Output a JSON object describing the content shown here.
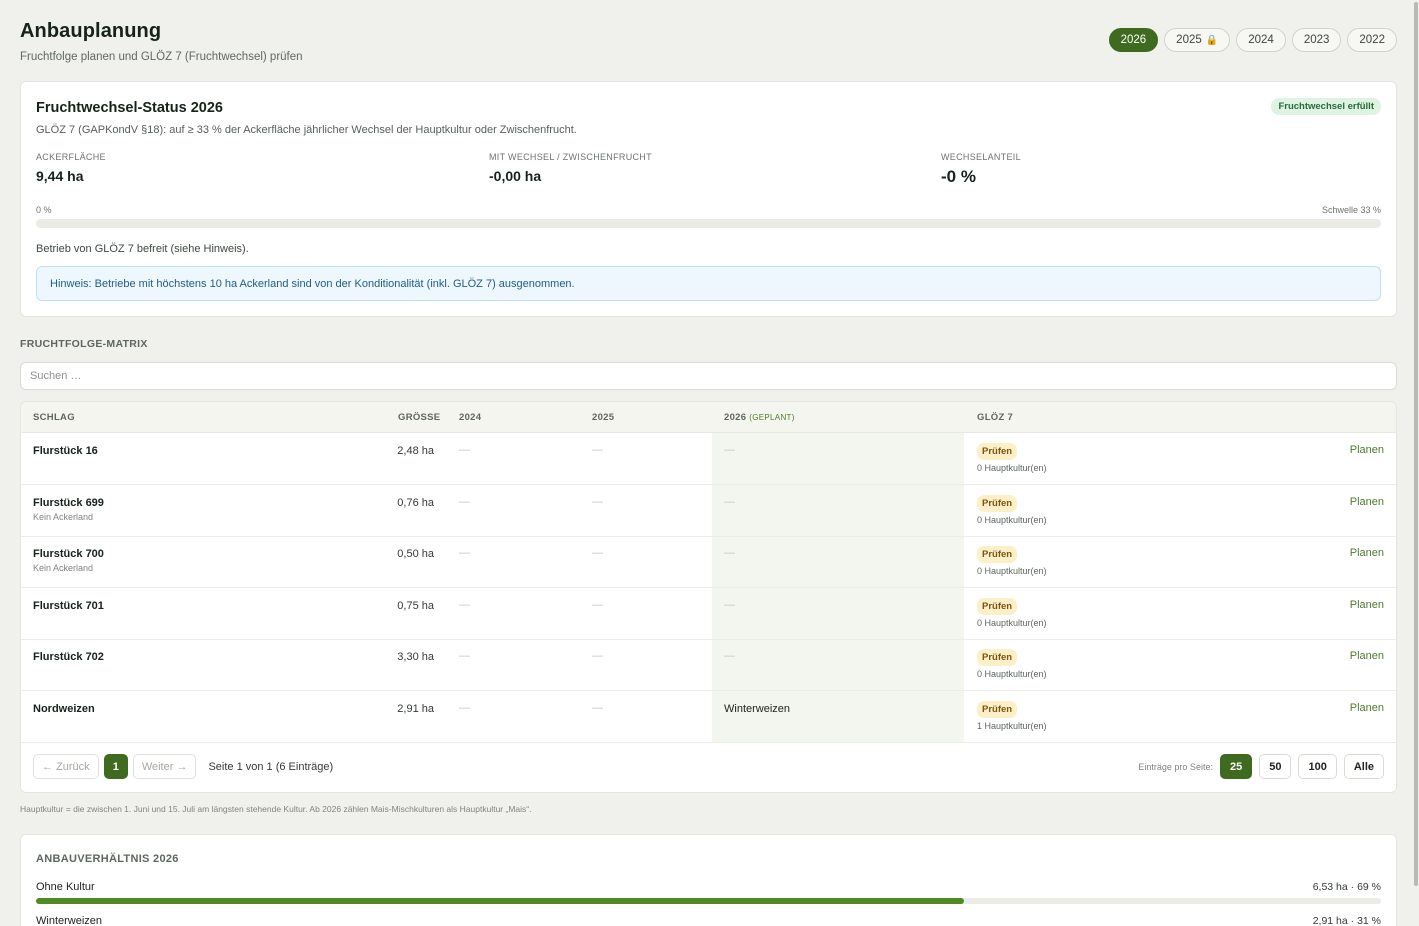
{
  "header": {
    "title": "Anbauplanung",
    "subtitle": "Fruchtfolge planen und GLÖZ 7 (Fruchtwechsel) prüfen"
  },
  "years": [
    {
      "label": "2026",
      "active": true,
      "locked": false
    },
    {
      "label": "2025",
      "active": false,
      "locked": true
    },
    {
      "label": "2024",
      "active": false,
      "locked": false
    },
    {
      "label": "2023",
      "active": false,
      "locked": false
    },
    {
      "label": "2022",
      "active": false,
      "locked": false
    }
  ],
  "status": {
    "title": "Fruchtwechsel-Status 2026",
    "description": "GLÖZ 7 (GAPKondV §18): auf ≥ 33 % der Ackerfläche jährlicher Wechsel der Hauptkultur oder Zwischenfrucht.",
    "badge": "Fruchtwechsel erfüllt",
    "stats": [
      {
        "label": "Ackerfläche",
        "value": "9,44 ha"
      },
      {
        "label": "Mit Wechsel / Zwischenfrucht",
        "value": "-0,00 ha"
      },
      {
        "label": "Wechselanteil",
        "value": "-0 %"
      }
    ],
    "progress_left": "0 %",
    "progress_right": "Schwelle 33 %",
    "progress_fraction": 0,
    "exempt_text": "Betrieb von GLÖZ 7 befreit (siehe Hinweis).",
    "hint": "Hinweis: Betriebe mit höchstens 10 ha Ackerland sind von der Konditionalität (inkl. GLÖZ 7) ausgenommen."
  },
  "matrix": {
    "section_title": "Fruchtfolge-Matrix",
    "search_placeholder": "Suchen …",
    "columns": {
      "schlag": "Schlag",
      "groesse": "Größe",
      "y2024": "2024",
      "y2025": "2025",
      "y2026": "2026",
      "y2026_note": "(geplant)",
      "gloez": "GLÖZ 7"
    },
    "rows": [
      {
        "name": "Flurstück 16",
        "note": "",
        "size": "2,48 ha",
        "c2024": "—",
        "c2025": "—",
        "c2026": "—",
        "check": "Prüfen",
        "hk": "0 Hauptkultur(en)",
        "action": "Planen"
      },
      {
        "name": "Flurstück 699",
        "note": "Kein Ackerland",
        "size": "0,76 ha",
        "c2024": "—",
        "c2025": "—",
        "c2026": "—",
        "check": "Prüfen",
        "hk": "0 Hauptkultur(en)",
        "action": "Planen"
      },
      {
        "name": "Flurstück 700",
        "note": "Kein Ackerland",
        "size": "0,50 ha",
        "c2024": "—",
        "c2025": "—",
        "c2026": "—",
        "check": "Prüfen",
        "hk": "0 Hauptkultur(en)",
        "action": "Planen"
      },
      {
        "name": "Flurstück 701",
        "note": "",
        "size": "0,75 ha",
        "c2024": "—",
        "c2025": "—",
        "c2026": "—",
        "check": "Prüfen",
        "hk": "0 Hauptkultur(en)",
        "action": "Planen"
      },
      {
        "name": "Flurstück 702",
        "note": "",
        "size": "3,30 ha",
        "c2024": "—",
        "c2025": "—",
        "c2026": "—",
        "check": "Prüfen",
        "hk": "0 Hauptkultur(en)",
        "action": "Planen"
      },
      {
        "name": "Nordweizen",
        "note": "",
        "size": "2,91 ha",
        "c2024": "—",
        "c2025": "—",
        "c2026": "Winterweizen",
        "check": "Prüfen",
        "hk": "1 Hauptkultur(en)",
        "action": "Planen"
      }
    ],
    "pager": {
      "prev": "← Zurück",
      "current": "1",
      "next": "Weiter →",
      "info": "Seite 1 von 1 (6 Einträge)",
      "per_page_label": "Einträge pro Seite:",
      "per_page_options": [
        "25",
        "50",
        "100",
        "Alle"
      ],
      "per_page_selected": "25"
    },
    "footnote": "Hauptkultur = die zwischen 1. Juni und 15. Juli am längsten stehende Kultur. Ab 2026 zählen Mais-Mischkulturen als Hauptkultur „Mais“."
  },
  "ratio": {
    "title": "Anbauverhältnis 2026",
    "items": [
      {
        "label": "Ohne Kultur",
        "value": "6,53 ha · 69 %",
        "fraction": 0.69
      },
      {
        "label": "Winterweizen",
        "value": "2,91 ha · 31 %",
        "fraction": 0.31
      }
    ]
  },
  "colors": {
    "accent": "#3e6b1f",
    "bar": "#4f8a24",
    "badge_ok_bg": "#dff3e3",
    "check_bg": "#fdf0c8",
    "hint_bg": "#eef7fd"
  }
}
